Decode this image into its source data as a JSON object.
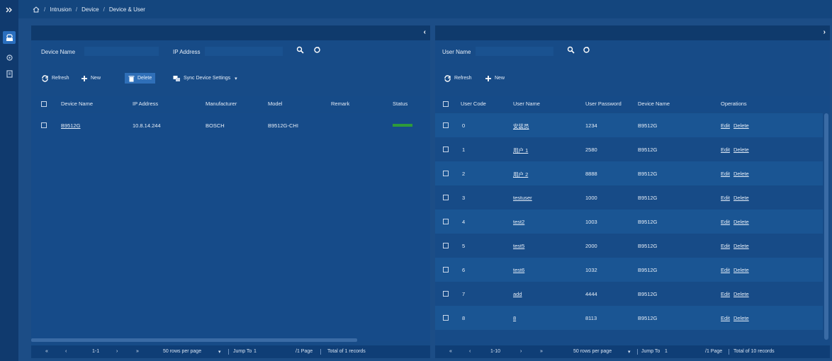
{
  "breadcrumb": {
    "items": [
      "Intrusion",
      "Device",
      "Device & User"
    ],
    "sep": "/"
  },
  "left": {
    "search": {
      "device_name_label": "Device Name",
      "device_name_value": "",
      "ip_label": "IP Address",
      "ip_value": ""
    },
    "toolbar": {
      "refresh": "Refresh",
      "new": "New",
      "delete": "Delete",
      "sync": "Sync Device Settings"
    },
    "columns": [
      "Device Name",
      "IP Address",
      "Manufacturer",
      "Model",
      "Remark",
      "Status"
    ],
    "rows": [
      {
        "device_name": "B9512G",
        "ip": "10.8.14.244",
        "manufacturer": "BOSCH",
        "model": "B9512G-CHI",
        "remark": "",
        "status": "online"
      }
    ],
    "pager": {
      "range": "1-1",
      "rows_per_page": "50 rows per page",
      "jump_to_label": "Jump To",
      "jump_to_value": "1",
      "page_suffix": "/1 Page",
      "total": "Total of 1 records"
    }
  },
  "right": {
    "search": {
      "user_name_label": "User Name",
      "user_name_value": ""
    },
    "toolbar": {
      "refresh": "Refresh",
      "new": "New"
    },
    "columns": [
      "User Code",
      "User Name",
      "User Password",
      "Device Name",
      "Operations"
    ],
    "rows": [
      {
        "code": "0",
        "name": "安装员",
        "password": "1234",
        "device": "B9512G",
        "edit": "Edit",
        "delete": "Delete"
      },
      {
        "code": "1",
        "name": "用户 1",
        "password": "2580",
        "device": "B9512G",
        "edit": "Edit",
        "delete": "Delete"
      },
      {
        "code": "2",
        "name": "用户 2",
        "password": "8888",
        "device": "B9512G",
        "edit": "Edit",
        "delete": "Delete"
      },
      {
        "code": "3",
        "name": "testuser",
        "password": "1000",
        "device": "B9512G",
        "edit": "Edit",
        "delete": "Delete"
      },
      {
        "code": "4",
        "name": "test2",
        "password": "1003",
        "device": "B9512G",
        "edit": "Edit",
        "delete": "Delete"
      },
      {
        "code": "5",
        "name": "test5",
        "password": "2000",
        "device": "B9512G",
        "edit": "Edit",
        "delete": "Delete"
      },
      {
        "code": "6",
        "name": "test6",
        "password": "1032",
        "device": "B9512G",
        "edit": "Edit",
        "delete": "Delete"
      },
      {
        "code": "7",
        "name": "add",
        "password": "4444",
        "device": "B9512G",
        "edit": "Edit",
        "delete": "Delete"
      },
      {
        "code": "8",
        "name": "8",
        "password": "8113",
        "device": "B9512G",
        "edit": "Edit",
        "delete": "Delete"
      }
    ],
    "pager": {
      "range": "1-10",
      "rows_per_page": "50 rows per page",
      "jump_to_label": "Jump To",
      "jump_to_value": "1",
      "page_suffix": "/1 Page",
      "total": "Total of 10 records"
    }
  },
  "colors": {
    "background": "#1c4d86",
    "sidebar": "#103a6e",
    "accent": "#2f6fb8",
    "status_online": "#2e9b3a"
  },
  "icons": {
    "sidebar": [
      "expand-icon",
      "intrusion-icon",
      "settings-icon",
      "report-icon"
    ]
  }
}
